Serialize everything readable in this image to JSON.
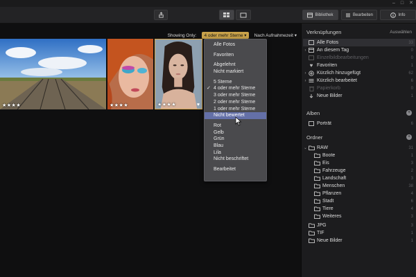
{
  "window": {
    "controls": [
      "–",
      "□",
      "✕"
    ]
  },
  "toolbar": {
    "tabs": [
      {
        "label": "Bibliothek",
        "icon": "library-icon"
      },
      {
        "label": "Bearbeiten",
        "icon": "edit-icon"
      },
      {
        "label": "Info",
        "icon": "info-icon"
      }
    ]
  },
  "filter": {
    "showing_label": "Showing Only:",
    "active_filter": "4 oder mehr Sterne ▾",
    "sort_label": "Nach Aufnahmezeit ▾"
  },
  "photos": [
    {
      "stars": "★★★★",
      "favorite": false
    },
    {
      "stars": "★★★★",
      "favorite": false
    },
    {
      "stars": "★★★★",
      "favorite": true,
      "selected": true
    }
  ],
  "dropdown": {
    "items": [
      "Alle Fotos",
      "Favoriten",
      "Abgelehnt",
      "Nicht markiert",
      "5 Sterne",
      "4 oder mehr Sterne",
      "3 oder mehr Sterne",
      "2 oder mehr Sterne",
      "1 oder mehr Sterne",
      "Nicht bewertet",
      "Rot",
      "Gelb",
      "Grün",
      "Blau",
      "Lila",
      "Nicht beschriftet",
      "Bearbeitet"
    ],
    "checked": "4 oder mehr Sterne",
    "highlighted": "Nicht bewertet"
  },
  "panel": {
    "shortcuts": {
      "title": "Verknüpfungen",
      "action": "Auswählen",
      "items": [
        {
          "label": "Alle Fotos",
          "count": "33"
        },
        {
          "label": "An diesem Tag",
          "count": "0"
        },
        {
          "label": "Einzelbildbearbeitungen",
          "count": "0"
        },
        {
          "label": "Favoriten",
          "count": "1"
        },
        {
          "label": "Kürzlich hinzugefügt",
          "count": "62"
        },
        {
          "label": "Kürzlich bearbeitet",
          "count": "6"
        },
        {
          "label": "Papierkorb",
          "count": "0"
        },
        {
          "label": "Neue Bilder",
          "count": "1"
        }
      ]
    },
    "albums": {
      "title": "Alben",
      "items": [
        {
          "label": "Porträt",
          "count": "6"
        }
      ]
    },
    "folders": {
      "title": "Ordner",
      "items": [
        {
          "label": "RAW",
          "count": "31"
        },
        {
          "label": "Boote",
          "count": "1"
        },
        {
          "label": "Eis",
          "count": "3"
        },
        {
          "label": "Fahrzeuge",
          "count": "2"
        },
        {
          "label": "Landschaft",
          "count": "3"
        },
        {
          "label": "Menschen",
          "count": "38"
        },
        {
          "label": "Pflanzen",
          "count": "4"
        },
        {
          "label": "Stadt",
          "count": "6"
        },
        {
          "label": "Tiere",
          "count": "4"
        },
        {
          "label": "Weiteres",
          "count": "3"
        },
        {
          "label": "JPG",
          "count": "3"
        },
        {
          "label": "TIF",
          "count": "1"
        },
        {
          "label": "Neue Bilder",
          "count": "1"
        }
      ]
    }
  },
  "colors": {
    "accent": "#c9a24a",
    "highlight": "#6470a8",
    "panel_bg": "#1c1c1e"
  }
}
